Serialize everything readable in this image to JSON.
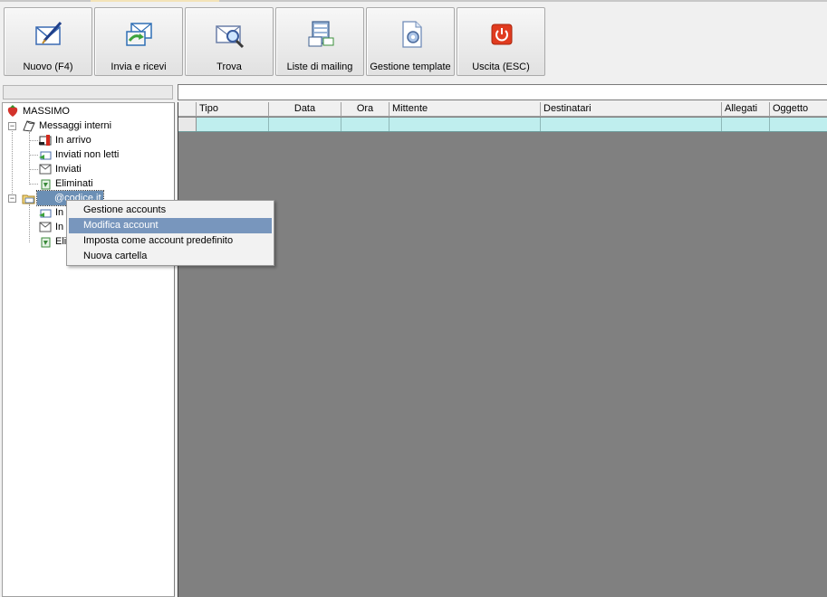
{
  "toolbar": {
    "buttons": [
      {
        "label": "Nuovo (F4)",
        "icon": "new-message-icon"
      },
      {
        "label": "Invia e ricevi",
        "icon": "send-receive-icon"
      },
      {
        "label": "Trova",
        "icon": "find-icon"
      },
      {
        "label": "Liste di mailing",
        "icon": "mailing-list-icon"
      },
      {
        "label": "Gestione template",
        "icon": "template-icon"
      },
      {
        "label": "Uscita (ESC)",
        "icon": "exit-icon"
      }
    ]
  },
  "tree": {
    "root": "MASSIMO",
    "internal": {
      "label": "Messaggi interni",
      "children": [
        "In arrivo",
        "Inviati non letti",
        "Inviati",
        "Eliminati"
      ]
    },
    "account": {
      "label": "@codice.it",
      "children": [
        "In",
        "In",
        "Eli"
      ]
    }
  },
  "grid": {
    "columns": [
      "Tipo",
      "Data",
      "Ora",
      "Mittente",
      "Destinatari",
      "Allegati",
      "Oggetto"
    ]
  },
  "context_menu": {
    "items": [
      "Gestione accounts",
      "Modifica account",
      "Imposta come account predefinito",
      "Nuova cartella"
    ],
    "highlighted_index": 1
  },
  "colors": {
    "selection": "#7896bd",
    "grid_background": "#808080",
    "row_highlight": "#bfeeee",
    "exit_red": "#e03b1f"
  }
}
